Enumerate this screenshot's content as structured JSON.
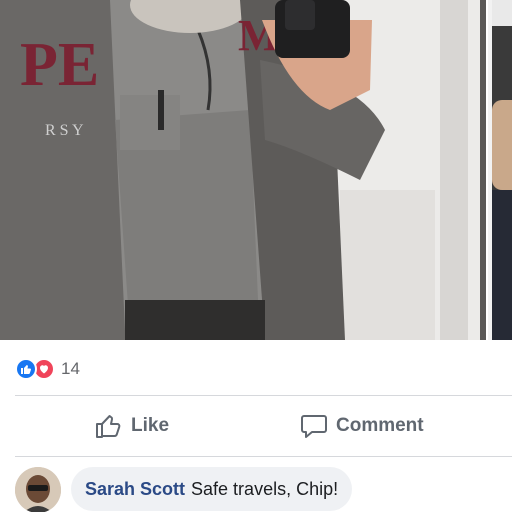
{
  "post": {
    "photo": {
      "description_icon": "mirror-selfie-photo",
      "sweatshirt_lettering": "PE"
    },
    "next_photo_peek": "next-photo-thumbnail"
  },
  "reactions": {
    "icons": [
      "like-icon",
      "love-icon"
    ],
    "count": "14",
    "like_color": "#1877f2",
    "love_color": "#f0445a"
  },
  "actions": {
    "like_label": "Like",
    "comment_label": "Comment"
  },
  "comments": [
    {
      "author": "Sarah Scott",
      "text": "Safe travels, Chip!"
    }
  ],
  "colors": {
    "action_text": "#606770",
    "author_link": "#2b4a86",
    "bubble_bg": "#eff1f4",
    "divider": "#d6d8dc"
  }
}
